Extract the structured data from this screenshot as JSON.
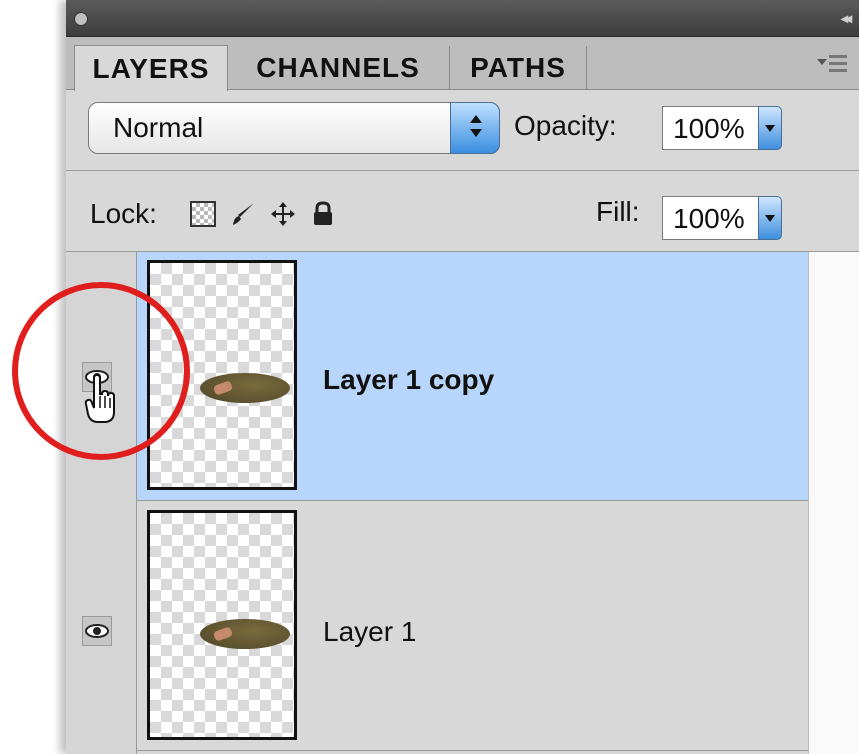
{
  "panel": {
    "tabs": [
      {
        "label": "LAYERS",
        "active": true
      },
      {
        "label": "CHANNELS",
        "active": false
      },
      {
        "label": "PATHS",
        "active": false
      }
    ],
    "blend_mode": {
      "value": "Normal"
    },
    "opacity": {
      "label": "Opacity:",
      "value": "100%"
    },
    "lock": {
      "label": "Lock:"
    },
    "fill": {
      "label": "Fill:",
      "value": "100%"
    }
  },
  "layers": [
    {
      "name": "Layer 1 copy",
      "selected": true,
      "visible": true
    },
    {
      "name": "Layer 1",
      "selected": false,
      "visible": true
    }
  ],
  "icons": {
    "panel_menu": "panel-menu-icon",
    "collapse": "collapse-double-arrow-icon",
    "lock_transparent": "lock-transparent-pixels-icon",
    "lock_image": "brush-icon",
    "lock_position": "move-arrows-icon",
    "lock_all": "padlock-icon",
    "eye": "eye-icon",
    "cursor": "hand-pointer-icon"
  },
  "colors": {
    "selected_row": "#b8d6fb",
    "highlight_circle": "#e01e1e",
    "accent_blue": "#3a8ee0"
  }
}
